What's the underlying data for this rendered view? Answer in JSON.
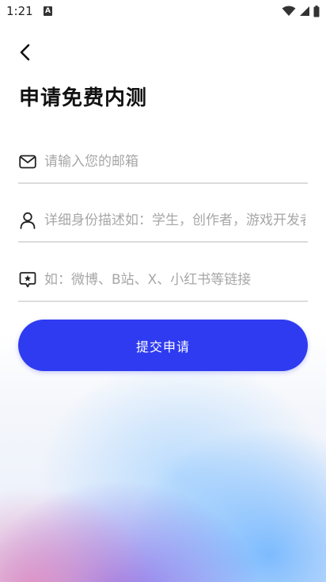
{
  "status_bar": {
    "time": "1:21",
    "app_icon_letter": "A"
  },
  "header": {
    "back_icon": "chevron-left-icon"
  },
  "page": {
    "title": "申请免费内测"
  },
  "form": {
    "email": {
      "icon": "mail-icon",
      "value": "",
      "placeholder": "请输入您的邮箱"
    },
    "description": {
      "icon": "person-icon",
      "value": "",
      "placeholder": "详细身份描述如：学生，创作者，游戏开发者"
    },
    "link": {
      "icon": "chat-star-icon",
      "value": "",
      "placeholder": "如：微博、B站、X、小红书等链接"
    },
    "submit_label": "提交申请"
  },
  "colors": {
    "accent": "#2f3bf0",
    "divider": "#dcdcdc",
    "placeholder": "#a7a7a7"
  }
}
